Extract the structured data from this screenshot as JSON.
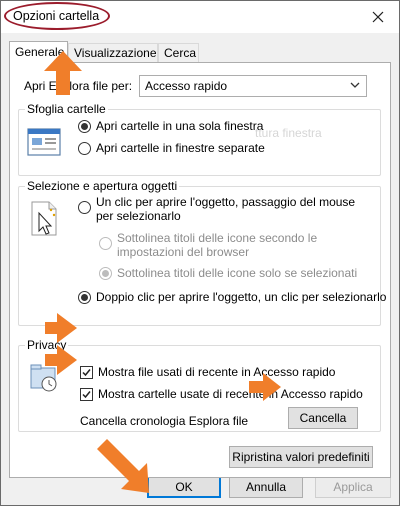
{
  "window": {
    "title": "Opzioni cartella"
  },
  "tabs": [
    {
      "label": "Generale"
    },
    {
      "label": "Visualizzazione"
    },
    {
      "label": "Cerca"
    }
  ],
  "open_explorer": {
    "label": "Apri Esplora file per:",
    "selected": "Accesso rapido"
  },
  "browse_folders": {
    "title": "Sfoglia cartelle",
    "options": [
      {
        "label": "Apri cartelle in una sola finestra",
        "selected": true
      },
      {
        "label": "Apri cartelle in finestre separate",
        "selected": false
      }
    ],
    "ghost_text": "ttura finestra"
  },
  "click_items": {
    "title": "Selezione e apertura oggetti",
    "single_click": {
      "label_line1": "Un clic per aprire l'oggetto, passaggio del mouse",
      "label_line2": "per selezionarlo",
      "selected": false
    },
    "underline_browser": {
      "label_line1": "Sottolinea titoli delle icone secondo le",
      "label_line2": "impostazioni del browser",
      "selected": false
    },
    "underline_hover": {
      "label": "Sottolinea titoli delle icone solo se selezionati",
      "selected": true
    },
    "double_click": {
      "label": "Doppio clic per aprire l'oggetto, un clic per selezionarlo",
      "selected": true
    }
  },
  "privacy": {
    "title": "Privacy",
    "show_recent_files": {
      "label": "Mostra file usati di recente in Accesso rapido",
      "checked": true
    },
    "show_frequent_folders": {
      "label": "Mostra cartelle usate di recente in Accesso rapido",
      "checked": true
    },
    "clear_history_label": "Cancella cronologia Esplora file",
    "clear_button": "Cancella"
  },
  "restore_defaults_button": "Ripristina valori predefiniti",
  "footer": {
    "ok": "OK",
    "cancel": "Annulla",
    "apply": "Applica"
  },
  "colors": {
    "annotation_arrow": "#f07e2a",
    "title_ellipse": "#9b1c2c",
    "default_button_border": "#0078d7"
  }
}
